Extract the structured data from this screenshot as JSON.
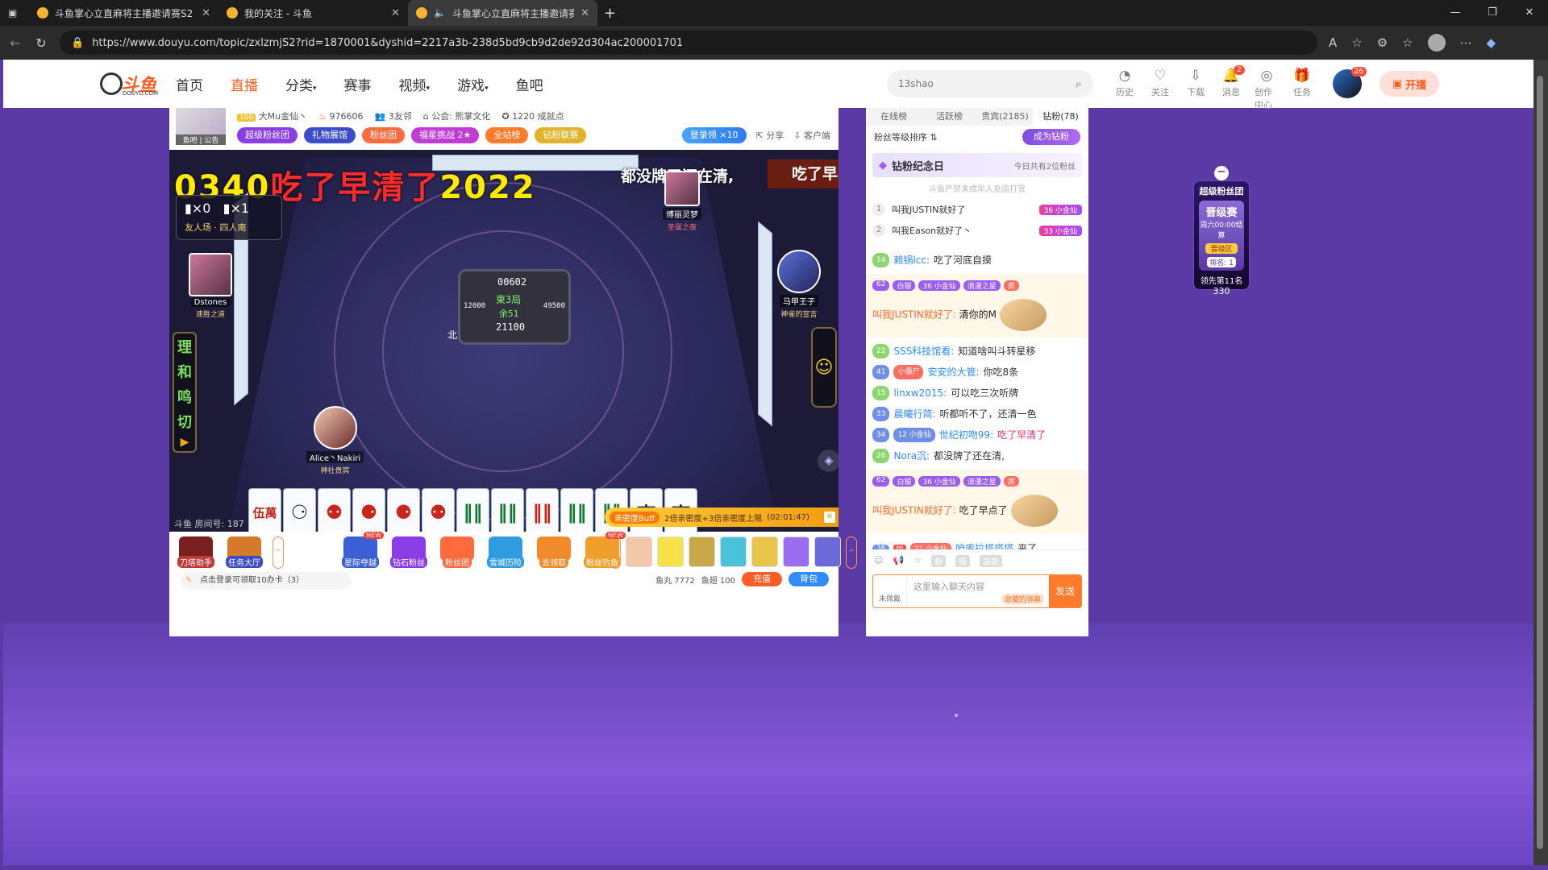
{
  "browser": {
    "tabs": [
      {
        "title": "斗鱼掌心立直麻将主播邀请赛S2",
        "active": false
      },
      {
        "title": "我的关注 - 斗鱼",
        "active": false
      },
      {
        "title": "斗鱼掌心立直麻将主播邀请赛",
        "active": true
      }
    ],
    "url": "https://www.douyu.com/topic/zxlzmjS2?rid=1870001&dyshid=2217a3b-238d5bd9cb9d2de92d304ac200001701"
  },
  "header": {
    "logo_text": "斗鱼",
    "logo_sub": "DOUYU.COM",
    "nav": [
      "首页",
      "直播",
      "分类",
      "赛事",
      "视频",
      "游戏",
      "鱼吧"
    ],
    "active_nav": "直播",
    "search_value": "13shao",
    "icons": [
      {
        "label": "历史",
        "icon": "history-icon",
        "glyph": "◔"
      },
      {
        "label": "关注",
        "icon": "heart-icon",
        "glyph": "♡"
      },
      {
        "label": "下载",
        "icon": "download-icon",
        "glyph": "⇩"
      },
      {
        "label": "消息",
        "icon": "bell-icon",
        "glyph": "🔔",
        "badge": "2"
      },
      {
        "label": "创作中心",
        "icon": "bulb-icon",
        "glyph": "◎"
      },
      {
        "label": "任务",
        "icon": "gift-icon",
        "glyph": "🎁"
      }
    ],
    "avatar_badge": "26",
    "live_button": "开播"
  },
  "anchor": {
    "avatar_caption": "鱼吧 | 公告",
    "level": "100",
    "name": "大Mu金仙丶",
    "hot": "976606",
    "friends": "3友邻",
    "guild": "公会: 熊掌文化",
    "achievements": "1220 成就点",
    "chips": [
      {
        "label": "超级粉丝团",
        "color": "#8a3de6"
      },
      {
        "label": "礼物展馆",
        "color": "#3d4cc9"
      },
      {
        "label": "粉丝团",
        "color": "#ff6b3d"
      },
      {
        "label": "福星挑战 2★",
        "color": "#c23bd6"
      },
      {
        "label": "全站榜",
        "color": "#ff7a2a"
      },
      {
        "label": "钻粉联赛",
        "color": "#e0b32a"
      }
    ],
    "login_reward": "登录领 ×10",
    "share": "分享",
    "client": "客户端"
  },
  "video": {
    "timer_yellow": "0340",
    "timer_red": "吃了早清了",
    "timer_tail": "2022",
    "danmu": "都没牌了还在清,",
    "banner": "吃了早",
    "score": {
      "a": "▮×0",
      "b": "▮×1",
      "sub": "友人场 · 四人南"
    },
    "players": [
      {
        "name": "Dstones",
        "title": "速胜之道"
      },
      {
        "name": "博丽灵梦",
        "title": "圣诞之夜"
      },
      {
        "name": "马甲王子",
        "title": "神雀的宣言"
      },
      {
        "name": "Alice丶Nakiri",
        "title": "神社贵宾"
      }
    ],
    "center": {
      "top": "00602",
      "round": "東3局",
      "sticks": "余51",
      "bottom": "21100",
      "left": "12000",
      "right": "49500",
      "wind": "北"
    },
    "side_keys": [
      "理",
      "和",
      "鸣",
      "切"
    ],
    "hand_tiles": [
      {
        "label": "伍萬",
        "cls": "red"
      },
      {
        "label": "⚆",
        "cls": "dk"
      },
      {
        "label": "⚉",
        "cls": "red"
      },
      {
        "label": "⚈",
        "cls": "red"
      },
      {
        "label": "⚈",
        "cls": "red"
      },
      {
        "label": "⚉",
        "cls": "red"
      },
      {
        "label": "‖‖",
        "cls": ""
      },
      {
        "label": "‖‖",
        "cls": ""
      },
      {
        "label": "‖‖",
        "cls": "red"
      },
      {
        "label": "‖‖",
        "cls": ""
      },
      {
        "label": "‖‖",
        "cls": ""
      },
      {
        "label": "東",
        "cls": "dk"
      },
      {
        "label": "東",
        "cls": "dk"
      }
    ],
    "room_no": "斗鱼 房间号: 187",
    "buff_tag": "亲密度Buff",
    "buff_text": "2倍亲密度+3倍亲密度上限",
    "buff_time": "(02:01:47)"
  },
  "toolbar": {
    "left_items": [
      {
        "label": "刀塔助手",
        "color": "#7a1f1f"
      },
      {
        "label": "任务大厅",
        "color": "#d47a2a"
      }
    ],
    "mid_items": [
      {
        "label": "星际夺越",
        "color": "#3d5fd6",
        "new": true
      },
      {
        "label": "钻石粉丝",
        "color": "#8a3de6",
        "new": false
      },
      {
        "label": "粉丝团",
        "color": "#ff6b3d",
        "new": false
      },
      {
        "label": "雪城历险",
        "color": "#2f9be0",
        "new": false
      },
      {
        "label": "去领取",
        "color": "#f08a2a",
        "new": false
      },
      {
        "label": "粉丝钓鱼",
        "color": "#f0a02a",
        "new": true
      }
    ],
    "gifts": [
      "#f2c8a8",
      "#f7e14a",
      "#c9a84a",
      "#4ac3d9",
      "#e9c54a",
      "#9b6df0",
      "#6a6ad8"
    ],
    "tip": "点击登录可领取10办卡（3）",
    "wallet_fish_ball": "鱼丸 7772",
    "wallet_fish_fin": "鱼翅 100",
    "recharge": "充值",
    "backpack": "背包"
  },
  "chat": {
    "tabs": [
      "在线榜",
      "活跃榜",
      "贵宾(2185)",
      "钻粉(78)"
    ],
    "active_tab": "钻粉(78)",
    "rank_label": "粉丝等级排序 ⇅",
    "become_diamond": "成为钻粉",
    "jinian": "钻粉纪念日",
    "jinian_right": "今日共有2位粉丝",
    "warning": "斗鱼严禁未成年人充值打赏",
    "rank_rows": [
      {
        "no": "1",
        "name": "叫我JUSTIN就好了",
        "lv": "36 小金仙"
      },
      {
        "no": "2",
        "name": "叫我Eason就好了丶",
        "lv": "33 小金仙"
      }
    ],
    "messages": [
      {
        "type": "msg",
        "lv": "14",
        "nick": "赖锅lcc:",
        "text": "吃了河底自摸",
        "red": false
      },
      {
        "type": "card",
        "tags": [
          "62",
          "白银",
          "36 小金仙",
          "浪漫之星",
          "房"
        ],
        "nick": "叫我JUSTIN就好了:",
        "text": "清你的M"
      },
      {
        "type": "msg",
        "lv": "22",
        "nick": "SSS科技馆看:",
        "text": "知道啥叫斗转星移",
        "red": false
      },
      {
        "type": "msg",
        "lv": "41",
        "nick": "安安的大管:",
        "text": "你吃8条",
        "red": false,
        "badge": "小僵尸"
      },
      {
        "type": "msg",
        "lv": "15",
        "nick": "linxw2015:",
        "text": "可以吃三次听牌",
        "red": false
      },
      {
        "type": "msg",
        "lv": "33",
        "nick": "晨曦行简:",
        "text": "听都听不了，还清一色",
        "red": false
      },
      {
        "type": "msg",
        "lv": "34",
        "nick": "世纪初吻99:",
        "text": "吃了早清了",
        "red": true,
        "badge": "12 小金仙"
      },
      {
        "type": "msg",
        "lv": "26",
        "nick": "Nora沉:",
        "text": "都没牌了还在清,",
        "red": false
      },
      {
        "type": "card",
        "tags": [
          "62",
          "白银",
          "36 小金仙",
          "浪漫之星",
          "房"
        ],
        "nick": "叫我JUSTIN就好了:",
        "text": "吃了早点了"
      }
    ],
    "entry": {
      "lv": "36",
      "hi": "Hi",
      "badge": "21 小金仙",
      "nick": "咱库拉塔塔塔",
      "text": "来了"
    },
    "composer_tools": [
      "☺",
      "📢",
      "☆",
      "粉",
      "模",
      "高能"
    ],
    "avatar_caption": "未佩戴",
    "placeholder": "这里输入聊天内容",
    "smart": "收藏的弹幕",
    "send": "发送"
  },
  "float": {
    "title": "超级粉丝团",
    "mode": "晋级赛",
    "countdown": "周六00:00结算",
    "zone": "晋级区",
    "rank": "排名: 1",
    "lead": "领先第11名",
    "lead_value": "330"
  }
}
